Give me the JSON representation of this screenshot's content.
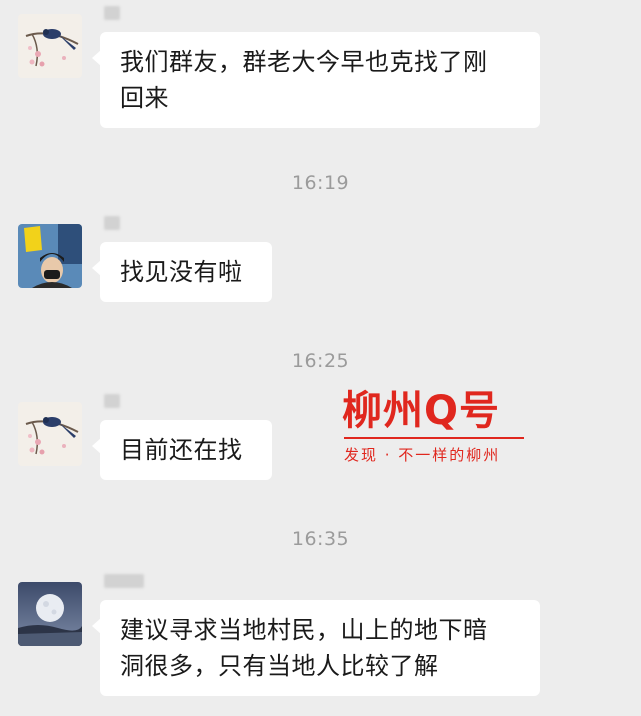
{
  "messages": [
    {
      "text_line1": "我们群友，群老大今早也克找了刚",
      "text_line2": "回来",
      "avatar": "bird-painting-avatar"
    },
    {
      "text": "找见没有啦",
      "avatar": "person-photo-avatar"
    },
    {
      "text": "目前还在找",
      "avatar": "bird-painting-avatar"
    },
    {
      "text_line1": "建议寻求当地村民，山上的地下暗",
      "text_line2": "洞很多，只有当地人比较了解",
      "avatar": "moon-landscape-avatar"
    }
  ],
  "timestamps": [
    "16:19",
    "16:25",
    "16:35"
  ],
  "watermark": {
    "title": "柳州Q号",
    "subtitle": "发现 · 不一样的柳州"
  },
  "colors": {
    "background": "#ededed",
    "bubble": "#ffffff",
    "watermark": "#e0271e",
    "timestamp": "#9b9b9b"
  }
}
